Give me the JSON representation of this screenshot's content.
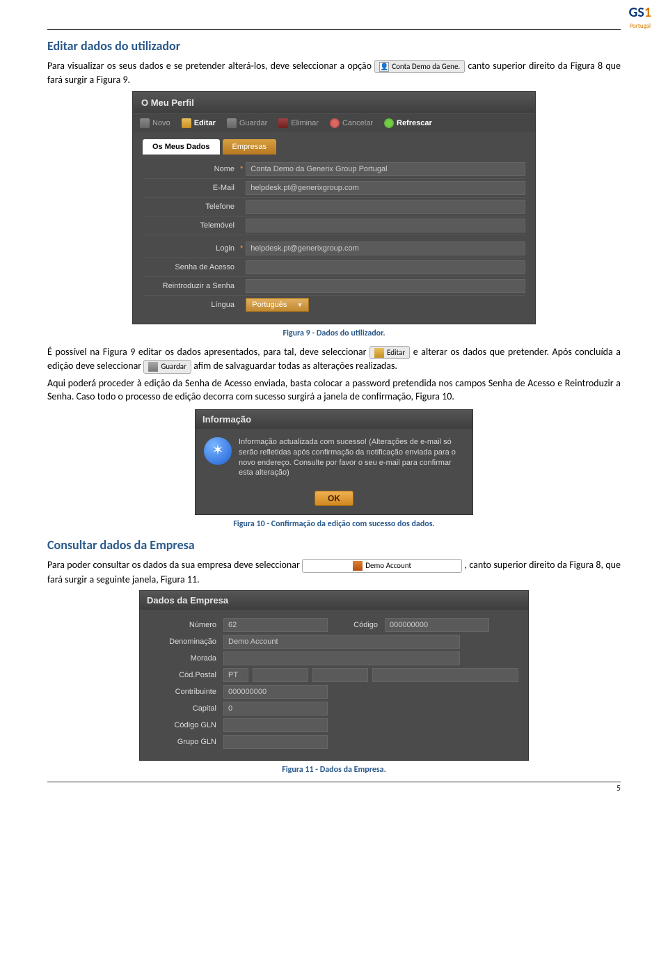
{
  "logo": {
    "brand": "GS",
    "one": "1",
    "region": "Portugal"
  },
  "heading1": "Editar dados do utilizador",
  "para1_a": "Para visualizar os seus dados e se pretender alterá-los, deve seleccionar a opção ",
  "chip_conta": "Conta Demo da Gene.",
  "para1_b": " canto superior direito da Figura 8 que fará surgir a Figura 9.",
  "perfil": {
    "title": "O Meu Perfil",
    "toolbar": {
      "novo": "Novo",
      "editar": "Editar",
      "guardar": "Guardar",
      "eliminar": "Eliminar",
      "cancelar": "Cancelar",
      "refrescar": "Refrescar"
    },
    "tabs": {
      "dados": "Os Meus Dados",
      "empresas": "Empresas"
    },
    "fields": {
      "nome_l": "Nome",
      "nome_v": "Conta Demo da Generix Group Portugal",
      "email_l": "E-Mail",
      "email_v": "helpdesk.pt@generixgroup.com",
      "telefone_l": "Telefone",
      "telemovel_l": "Telemóvel",
      "login_l": "Login",
      "login_v": "helpdesk.pt@generixgroup.com",
      "senha_l": "Senha de Acesso",
      "reintro_l": "Reintroduzir a Senha",
      "lingua_l": "Língua",
      "lingua_v": "Português"
    }
  },
  "caption9": "Figura 9 - Dados do utilizador.",
  "para2_a": "É possível na Figura 9 editar os dados apresentados, para tal, deve seleccionar ",
  "chip_editar": "Editar",
  "para2_b": " e alterar os dados que pretender. Após concluída a edição deve seleccionar ",
  "chip_guardar": "Guardar",
  "para2_c": " afim de salvaguardar todas as alterações realizadas.",
  "para3": "Aqui poderá proceder à edição da Senha de Acesso enviada, basta colocar a password pretendida nos campos Senha de Acesso e Reintroduzir a Senha. Caso todo o processo de edição decorra com sucesso surgirá a janela de confirmação, Figura 10.",
  "dialog": {
    "title": "Informação",
    "body": "Informação actualizada com sucesso! (Alterações de e-mail só serão refletidas após confirmação da notificação enviada para o novo endereço. Consulte por favor o seu e-mail para confirmar esta alteração)",
    "ok": "OK"
  },
  "caption10": "Figura 10 - Confirmação da edição com sucesso dos dados.",
  "heading2": "Consultar dados da Empresa",
  "para4_a": "Para poder consultar os dados da sua empresa deve seleccionar ",
  "chip_company": "Demo Account",
  "para4_b": ", canto superior direito da Figura 8, que fará surgir a seguinte janela, Figura 11.",
  "empresa": {
    "title": "Dados da Empresa",
    "numero_l": "Número",
    "numero_v": "62",
    "codigo_l": "Código",
    "codigo_v": "000000000",
    "denom_l": "Denominação",
    "denom_v": "Demo Account",
    "morada_l": "Morada",
    "codpostal_l": "Cód.Postal",
    "codpostal_v": "PT",
    "contrib_l": "Contribuinte",
    "contrib_v": "000000000",
    "capital_l": "Capital",
    "capital_v": "0",
    "glncode_l": "Código GLN",
    "glngrupo_l": "Grupo GLN"
  },
  "caption11": "Figura 11 - Dados da Empresa.",
  "pagenum": "5"
}
